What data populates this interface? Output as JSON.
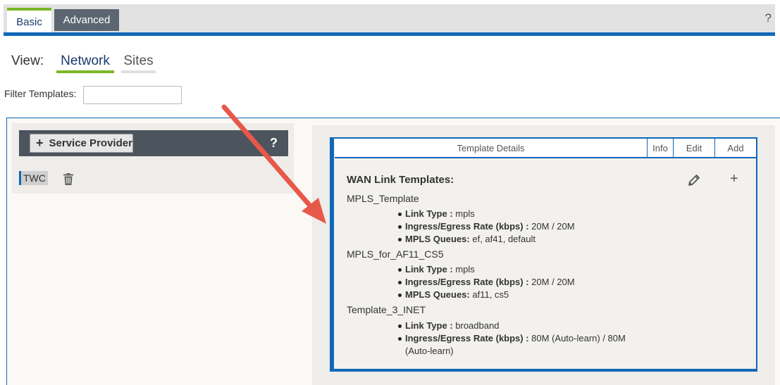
{
  "tabs": {
    "basic_label": "Basic",
    "advanced_label": "Advanced",
    "help_label": "?"
  },
  "view": {
    "label": "View:",
    "network_label": "Network",
    "sites_label": "Sites"
  },
  "filter": {
    "label": "Filter Templates:",
    "value": ""
  },
  "service_provider": {
    "button_label": "Service Provider",
    "help_label": "?",
    "items": [
      {
        "label": "TWC"
      }
    ]
  },
  "template_card": {
    "header": {
      "details_label": "Template Details",
      "info_label": "Info",
      "edit_label": "Edit",
      "add_label": "Add"
    },
    "title": "WAN Link Templates:",
    "templates": [
      {
        "name": "MPLS_Template",
        "fields": [
          {
            "key": "Link Type :",
            "value": " mpls"
          },
          {
            "key": "Ingress/Egress Rate (kbps) :",
            "value": " 20M / 20M"
          },
          {
            "key": "MPLS Queues:",
            "value": " ef, af41, default"
          }
        ]
      },
      {
        "name": "MPLS_for_AF11_CS5",
        "fields": [
          {
            "key": "Link Type :",
            "value": " mpls"
          },
          {
            "key": "Ingress/Egress Rate (kbps) :",
            "value": " 20M / 20M"
          },
          {
            "key": "MPLS Queues:",
            "value": " af11, cs5"
          }
        ]
      },
      {
        "name": "Template_3_INET",
        "fields": [
          {
            "key": "Link Type :",
            "value": " broadband"
          },
          {
            "key": "Ingress/Egress Rate (kbps) :",
            "value": " 80M (Auto-learn) / 80M (Auto-learn)"
          }
        ]
      }
    ]
  },
  "colors": {
    "accent_blue": "#1068b8",
    "accent_green": "#7ab826",
    "annotation_arrow": "#e8584a"
  },
  "icons": {
    "trash": "trash-icon",
    "pencil": "pencil-icon",
    "plus": "plus-icon"
  }
}
